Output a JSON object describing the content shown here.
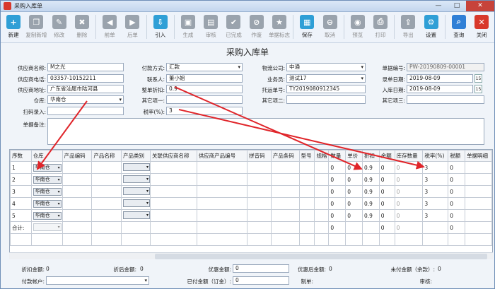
{
  "window": {
    "title": "采购入库单",
    "min": "—",
    "max": "□",
    "close": "✕"
  },
  "toolbar": [
    {
      "label": "新建",
      "icon": "new-icon",
      "color": "#2f9fd6",
      "glyph": "+",
      "enabled": true
    },
    {
      "label": "复制新增",
      "icon": "copy-new-icon",
      "color": "#9aa3ad",
      "glyph": "❐",
      "enabled": false
    },
    {
      "label": "修改",
      "icon": "edit-icon",
      "color": "#9aa3ad",
      "glyph": "✎",
      "enabled": false
    },
    {
      "label": "删除",
      "icon": "delete-icon",
      "color": "#9aa3ad",
      "glyph": "✖",
      "enabled": false
    },
    {
      "label": "前单",
      "icon": "prev-icon",
      "color": "#9aa3ad",
      "glyph": "◀",
      "enabled": false
    },
    {
      "label": "后单",
      "icon": "next-icon",
      "color": "#9aa3ad",
      "glyph": "▶",
      "enabled": false
    },
    {
      "label": "引入",
      "icon": "import-icon",
      "color": "#2f9fd6",
      "glyph": "⇩",
      "enabled": true
    },
    {
      "label": "生成",
      "icon": "generate-icon",
      "color": "#9aa3ad",
      "glyph": "▣",
      "enabled": false
    },
    {
      "label": "审核",
      "icon": "audit-icon",
      "color": "#9aa3ad",
      "glyph": "▤",
      "enabled": false
    },
    {
      "label": "已完成",
      "icon": "completed-icon",
      "color": "#9aa3ad",
      "glyph": "✔",
      "enabled": false
    },
    {
      "label": "作废",
      "icon": "void-icon",
      "color": "#9aa3ad",
      "glyph": "⊘",
      "enabled": false
    },
    {
      "label": "单据标志",
      "icon": "flag-icon",
      "color": "#9aa3ad",
      "glyph": "★",
      "enabled": false
    },
    {
      "label": "保存",
      "icon": "save-icon",
      "color": "#2f9fd6",
      "glyph": "▦",
      "enabled": true
    },
    {
      "label": "取消",
      "icon": "cancel-icon",
      "color": "#9aa3ad",
      "glyph": "⊖",
      "enabled": false
    },
    {
      "label": "预览",
      "icon": "preview-icon",
      "color": "#9aa3ad",
      "glyph": "◉",
      "enabled": false
    },
    {
      "label": "打印",
      "icon": "print-icon",
      "color": "#9aa3ad",
      "glyph": "⎙",
      "enabled": false
    },
    {
      "label": "导出",
      "icon": "export-icon",
      "color": "#9aa3ad",
      "glyph": "⇪",
      "enabled": false
    },
    {
      "label": "设置",
      "icon": "settings-icon",
      "color": "#2f9fd6",
      "glyph": "⚙",
      "enabled": true
    },
    {
      "label": "查询",
      "icon": "search-icon",
      "color": "#2f7fd6",
      "glyph": "⌕",
      "enabled": true
    },
    {
      "label": "关闭",
      "icon": "close-icon",
      "color": "#d8382b",
      "glyph": "✕",
      "enabled": true
    }
  ],
  "form": {
    "title": "采购入库单",
    "supplier_name_label": "供应商名称:",
    "supplier_name": "M之光",
    "supplier_phone_label": "供应商电话:",
    "supplier_phone": "03357-10152211",
    "supplier_addr_label": "供应商地址:",
    "supplier_addr": "广东省汕尾市陆河县",
    "warehouse_label": "仓库:",
    "warehouse": "华南仓",
    "scan_label": "扫码录入:",
    "scan": "",
    "remark_label": "单据备注:",
    "remark": "",
    "pay_method_label": "付款方式:",
    "pay_method": "汇款",
    "contact_label": "联系人:",
    "contact": "董小姐",
    "discount_label": "整单折扣:",
    "discount": "0.9",
    "other1_label": "其它项一:",
    "other1": "",
    "tax_label": "税率(%):",
    "tax": "3",
    "logistics_label": "物流公司:",
    "logistics": "中通",
    "salesman_label": "业务员:",
    "salesman": "测试17",
    "tracking_label": "托运单号:",
    "tracking": "TY2019080912345",
    "other2_label": "其它项二:",
    "other2": "",
    "billno_label": "单据编号:",
    "billno": "PW-20190809-00001",
    "entry_date_label": "录单日期:",
    "entry_date": "2019-08-09",
    "stock_date_label": "入库日期:",
    "stock_date": "2019-08-09",
    "other3_label": "其它项三:",
    "other3": "",
    "cal": "15"
  },
  "grid": {
    "columns": [
      "序数",
      "仓库",
      "产品编码",
      "产品名称",
      "产品类别",
      "关联供应商名称",
      "供应商产品编号",
      "拼音码",
      "产品条码",
      "型号",
      "规格",
      "数量",
      "单价",
      "折扣",
      "金额",
      "库存数量",
      "税率(%)",
      "税额",
      "单据明细"
    ],
    "rows": [
      {
        "no": "1",
        "wh": "华南仓",
        "qty": "0",
        "price": "0",
        "disc": "0.9",
        "amt": "0",
        "stock": "0",
        "tax": "3",
        "taxamt": "0"
      },
      {
        "no": "2",
        "wh": "华南仓",
        "qty": "0",
        "price": "0",
        "disc": "0.9",
        "amt": "0",
        "stock": "0",
        "tax": "3",
        "taxamt": "0"
      },
      {
        "no": "3",
        "wh": "华南仓",
        "qty": "0",
        "price": "0",
        "disc": "0.9",
        "amt": "0",
        "stock": "0",
        "tax": "3",
        "taxamt": "0"
      },
      {
        "no": "4",
        "wh": "华南仓",
        "qty": "0",
        "price": "0",
        "disc": "0.9",
        "amt": "0",
        "stock": "0",
        "tax": "3",
        "taxamt": "0"
      },
      {
        "no": "5",
        "wh": "华南仓",
        "qty": "0",
        "price": "0",
        "disc": "0.9",
        "amt": "0",
        "stock": "0",
        "tax": "3",
        "taxamt": "0"
      }
    ],
    "total_label": "合计:",
    "total": {
      "qty": "0",
      "amt": "0",
      "stock": "0",
      "taxamt": "0"
    }
  },
  "footer": {
    "pre_disc_label": "折扣金额:",
    "pre_disc": "0",
    "post_disc_label": "折后金额:",
    "post_disc": "0",
    "promo_label": "优惠金额:",
    "promo": "0",
    "after_promo_label": "优惠后金额:",
    "after_promo": "0",
    "unpaid_label": "未付金额（余款）:",
    "unpaid": "0",
    "pay_account_label": "付款帐户:",
    "pay_account": "",
    "paid_label": "已付金额（订金）:",
    "paid": "0",
    "maker_label": "制单:",
    "maker": "",
    "auditor_label": "审核:",
    "auditor": ""
  },
  "colors": {
    "annotation_arrow": "#e0252a"
  }
}
